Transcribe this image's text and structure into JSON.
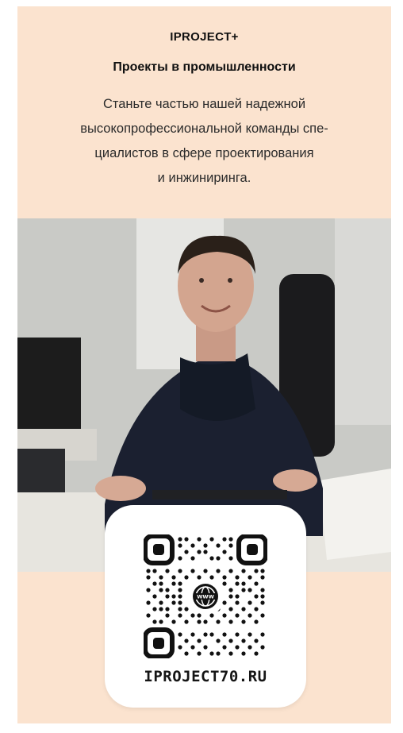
{
  "header": {
    "brand": "IPROJECT+",
    "subtitle": "Проекты в промышленности",
    "text_lines": [
      "Станьте частью нашей надежной",
      "высокопрофессиональной команды спе-",
      "циалистов в сфере проектирования",
      "и инжиниринга."
    ]
  },
  "photo": {
    "subject": "person-at-desk-photo"
  },
  "qr": {
    "url_text": "IPROJECT70.RU",
    "center_icon": "www-globe-icon"
  },
  "colors": {
    "background": "#fbe3cf",
    "text": "#111111",
    "qr_card": "#ffffff"
  }
}
